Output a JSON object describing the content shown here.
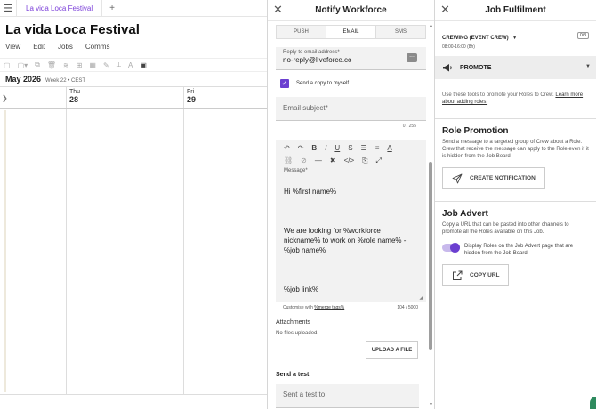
{
  "browser": {
    "tab_label": "La vida Loca Festival",
    "new_tab": "+"
  },
  "app": {
    "title": "La vida Loca Festival",
    "menu": [
      "View",
      "Edit",
      "Jobs",
      "Comms"
    ],
    "calendar": {
      "month": "May 2026",
      "week": "Week 22 • CEST",
      "days": [
        {
          "dow": "Thu",
          "num": "28"
        },
        {
          "dow": "Fri",
          "num": "29"
        }
      ]
    }
  },
  "notify": {
    "title": "Notify Workforce",
    "tabs": [
      "PUSH",
      "EMAIL",
      "SMS"
    ],
    "active_tab": "EMAIL",
    "reply_to": {
      "label": "Reply-to email address*",
      "value": "no-reply@liveforce.co"
    },
    "copy_to_myself": {
      "label": "Send a copy to myself",
      "checked": true
    },
    "subject": {
      "placeholder": "Email subject*",
      "counter": "0 / 255"
    },
    "message": {
      "label": "Message*",
      "lines": [
        "Hi %first name%",
        "",
        "We are looking for %workforce nickname% to work on %role name% - %job name%",
        "",
        "%job link%"
      ],
      "customise_prefix": "Customise with ",
      "customise_link": "%merge tags%",
      "counter": "104 / 5000"
    },
    "attachments": {
      "heading": "Attachments",
      "empty": "No files uploaded.",
      "upload_label": "UPLOAD A FILE"
    },
    "send_test": {
      "heading": "Send a test",
      "placeholder": "Sent a test to"
    }
  },
  "job": {
    "title": "Job Fulfilment",
    "crewing": {
      "name": "CREWING (EVENT CREW)",
      "badge": "0/3",
      "time": "08:00-16:00 (8h)"
    },
    "promote": {
      "label": "PROMOTE",
      "help": "Use these tools to promote your Roles to Crew.",
      "help_link": "Learn more about adding roles."
    },
    "role_promotion": {
      "heading": "Role Promotion",
      "text": "Send a message to a targeted group of Crew about a Role. Crew that receive the message can apply to the Role even if it is hidden from the Job Board.",
      "button": "CREATE NOTIFICATION"
    },
    "job_advert": {
      "heading": "Job Advert",
      "text": "Copy a URL that can be pasted into other channels to promote all the Roles available on this Job.",
      "toggle_label": "Display Roles on the Job Advert page that are hidden from the Job Board",
      "toggle_on": true,
      "button": "COPY URL"
    }
  },
  "colors": {
    "accent": "#6b3fd0",
    "tab_text": "#7b3fd9",
    "field_bg": "#f2f2f2"
  },
  "icons": {
    "close": "close-icon",
    "send": "paper-plane-icon",
    "copy_url": "external-link-icon",
    "promote": "megaphone-icon"
  }
}
